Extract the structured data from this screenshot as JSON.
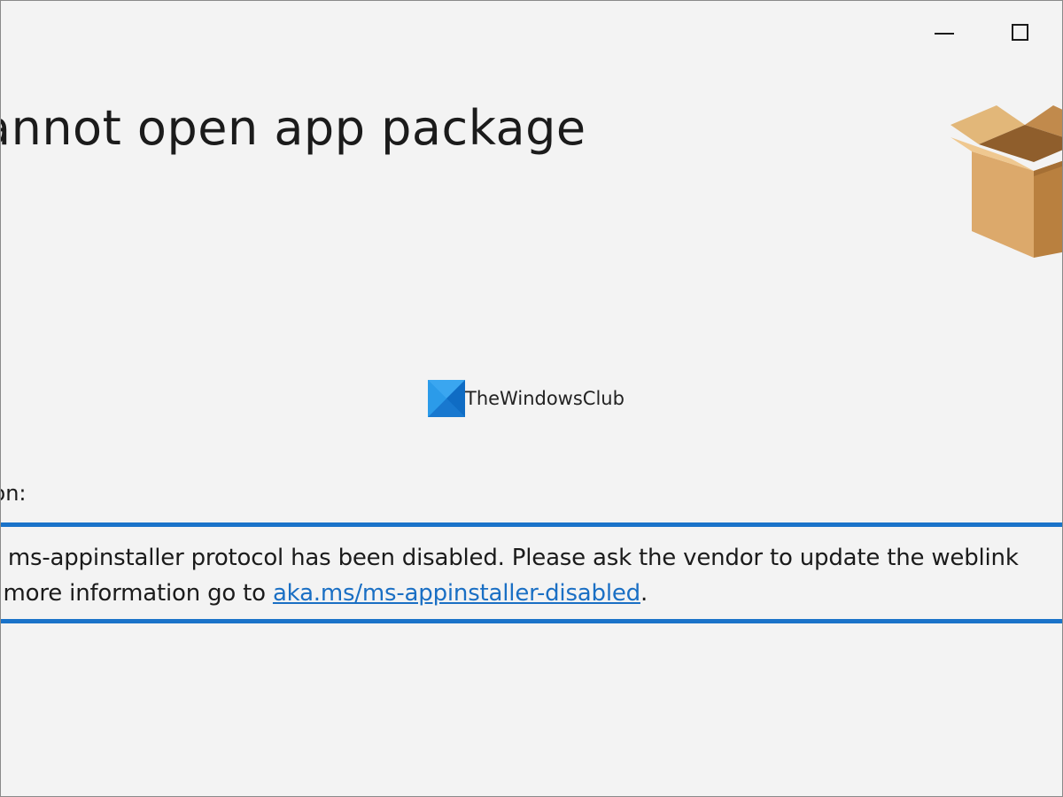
{
  "window": {
    "controls": {
      "minimize_icon": "minimize-icon",
      "maximize_icon": "maximize-icon"
    }
  },
  "title": "annot open app package",
  "package_icon": "package-box-icon",
  "watermark": {
    "text": "TheWindowsClub",
    "logo_icon": "thewindowsclub-logo-icon"
  },
  "reason": {
    "label": "son:",
    "line1": "e ms-appinstaller protocol has been disabled. Please ask the vendor to update the weblink",
    "line2_prefix": "r more information go to ",
    "link_text": "aka.ms/ms-appinstaller-disabled",
    "line2_suffix": "."
  },
  "colors": {
    "background": "#f3f3f3",
    "accent": "#1a73c9",
    "link": "#1a6fc4",
    "text": "#1b1b1b",
    "box_light": "#e0b47a",
    "box_mid": "#c9955a",
    "box_dark": "#a8733d"
  }
}
